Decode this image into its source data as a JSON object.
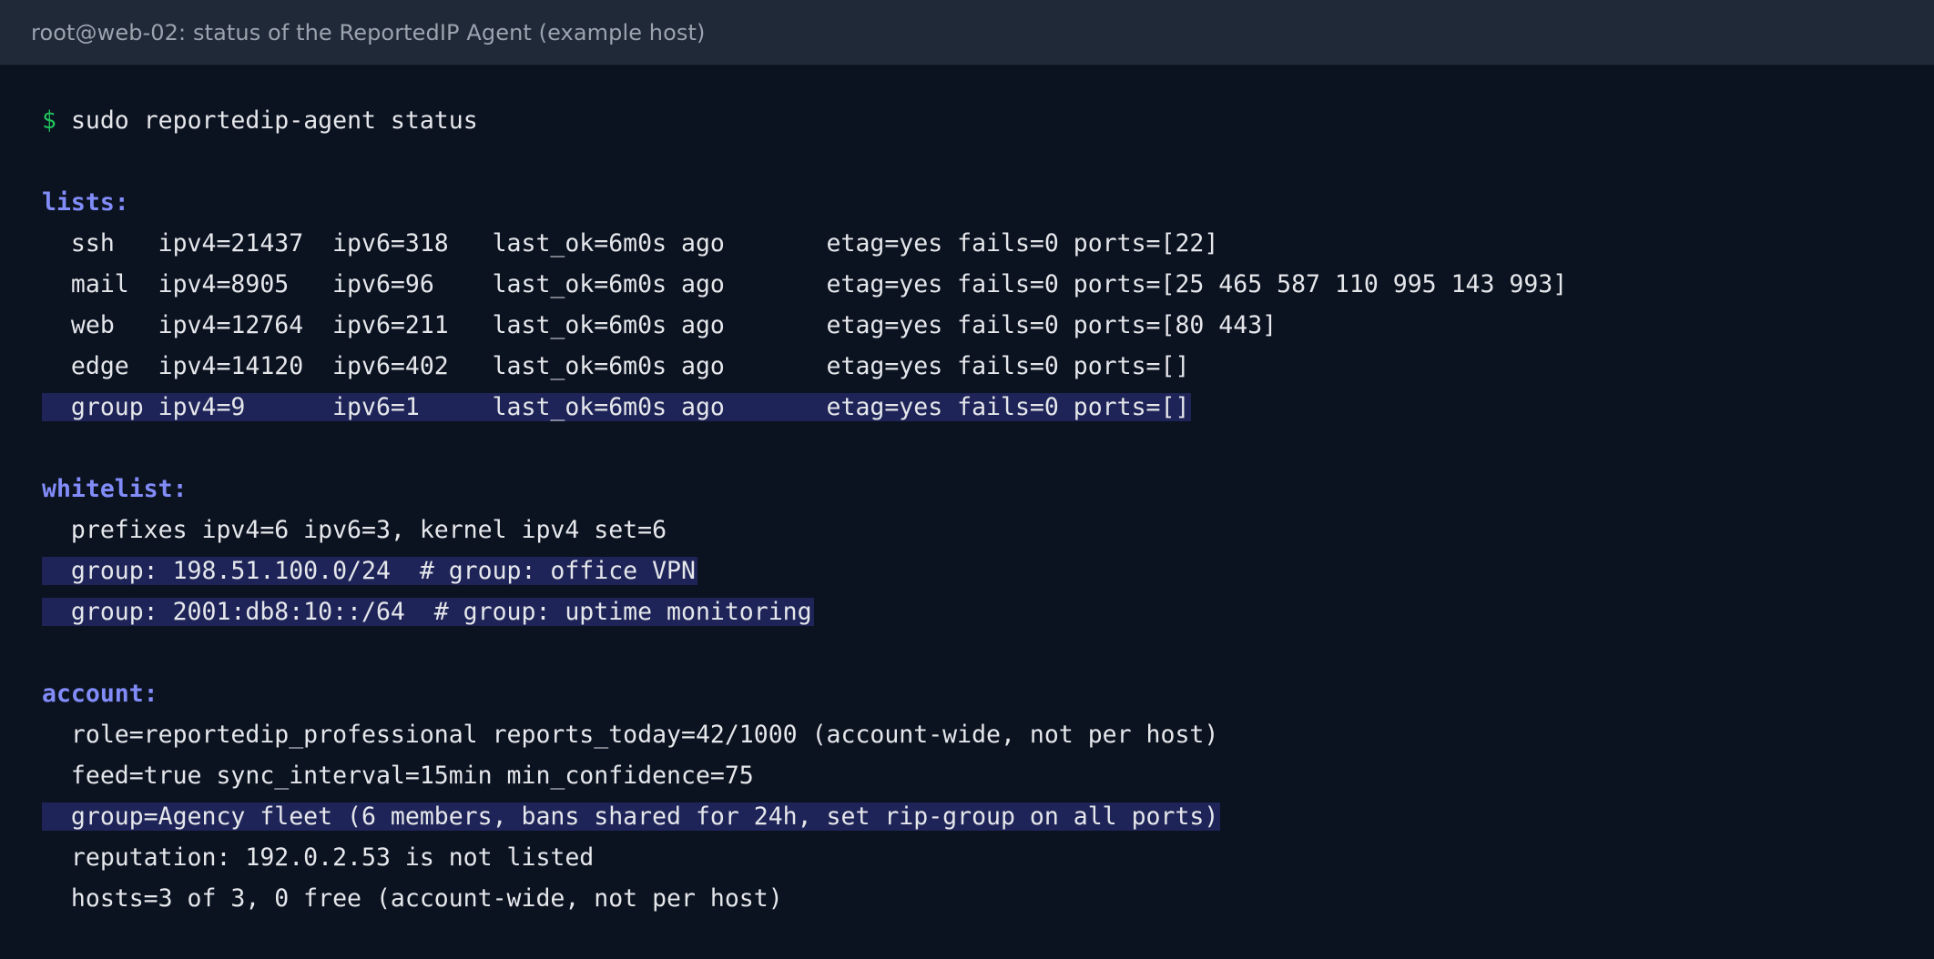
{
  "window": {
    "title": "root@web-02: status of the ReportedIP Agent (example host)"
  },
  "command": {
    "prompt": "$",
    "text": "sudo reportedip-agent status"
  },
  "lists": {
    "header": "lists:",
    "rows": [
      {
        "text": "  ssh   ipv4=21437  ipv6=318   last_ok=6m0s ago       etag=yes fails=0 ports=[22]"
      },
      {
        "text": "  mail  ipv4=8905   ipv6=96    last_ok=6m0s ago       etag=yes fails=0 ports=[25 465 587 110 995 143 993]"
      },
      {
        "text": "  web   ipv4=12764  ipv6=211   last_ok=6m0s ago       etag=yes fails=0 ports=[80 443]"
      },
      {
        "text": "  edge  ipv4=14120  ipv6=402   last_ok=6m0s ago       etag=yes fails=0 ports=[]"
      },
      {
        "text": "  group ipv4=9      ipv6=1     last_ok=6m0s ago       etag=yes fails=0 ports=[]"
      }
    ]
  },
  "whitelist": {
    "header": "whitelist:",
    "rows": [
      {
        "text": "  prefixes ipv4=6 ipv6=3, kernel ipv4 set=6"
      },
      {
        "text": "  group: 198.51.100.0/24  # group: office VPN"
      },
      {
        "text": "  group: 2001:db8:10::/64  # group: uptime monitoring"
      }
    ]
  },
  "account": {
    "header": "account:",
    "rows": [
      {
        "text": "  role=reportedip_professional reports_today=42/1000 (account-wide, not per host)"
      },
      {
        "text": "  feed=true sync_interval=15min min_confidence=75"
      },
      {
        "text": "  group=Agency fleet (6 members, bans shared for 24h, set rip-group on all ports)"
      },
      {
        "text": "  reputation: 192.0.2.53 is not listed"
      },
      {
        "text": "  hosts=3 of 3, 0 free (account-wide, not per host)"
      }
    ]
  },
  "colors": {
    "background": "#0b1220",
    "titlebar": "#1f2937",
    "prompt": "#22c55e",
    "section": "#818cf8",
    "highlight": "#1e2458",
    "text": "#e5e7eb"
  }
}
